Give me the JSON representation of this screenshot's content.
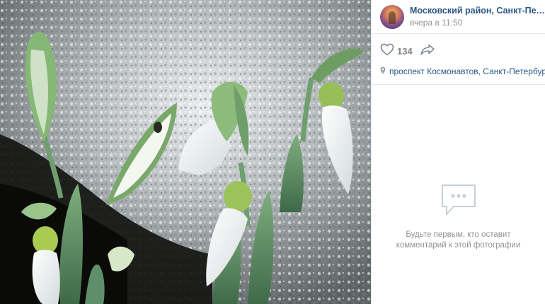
{
  "post": {
    "author_name": "Московский район, Санкт-Петербург",
    "time": "вчера в 11:50",
    "likes": "134",
    "location": "проспект Космонавтов, Санкт-Петербург"
  },
  "comments": {
    "empty_text": "Будьте первым, кто оставит комментарий к этой фотографии"
  },
  "icons": {
    "like": "heart-icon",
    "share": "share-arrow-icon",
    "location": "map-pin-icon",
    "empty": "comment-bubble-icon"
  },
  "colors": {
    "link": "#2a5885",
    "muted": "#939393",
    "like_count": "#828282"
  }
}
